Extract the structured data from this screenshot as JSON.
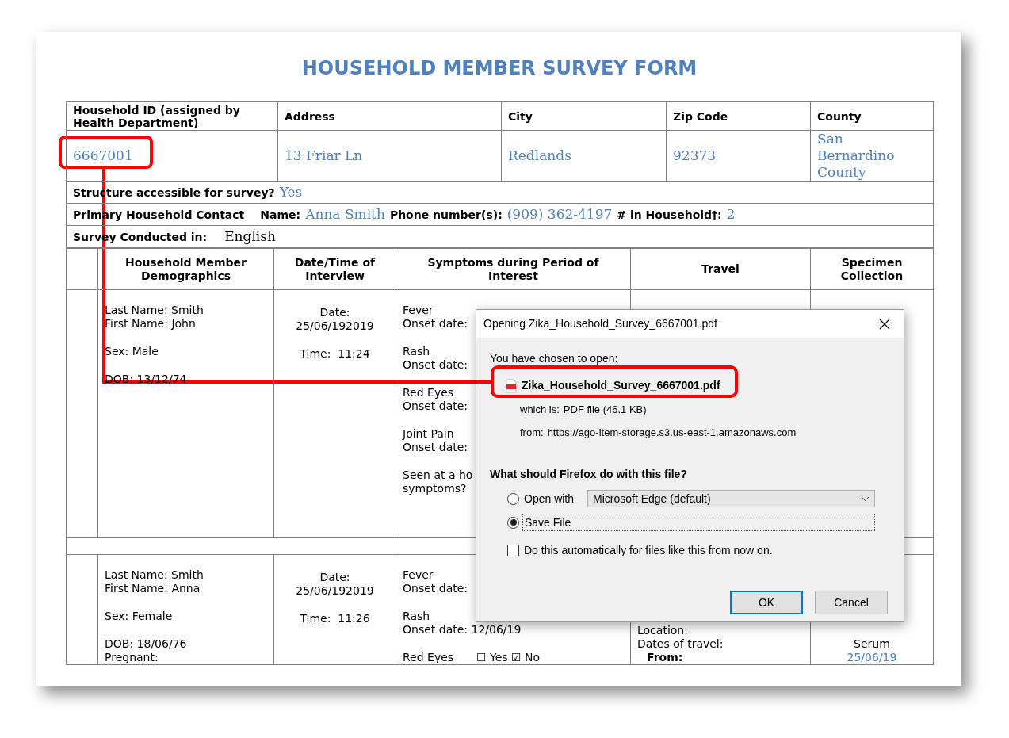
{
  "title": "HOUSEHOLD MEMBER SURVEY FORM",
  "household": {
    "columns": [
      "Household ID (assigned by Health Department)",
      "Address",
      "City",
      "Zip Code",
      "County"
    ],
    "values": [
      "6667001",
      "13 Friar Ln",
      "Redlands",
      "92373",
      "San Bernardino County"
    ]
  },
  "info_rows": [
    {
      "parts": [
        {
          "kind": "label",
          "text": "Structure accessible for survey?"
        },
        {
          "kind": "answer",
          "text": "Yes"
        }
      ]
    },
    {
      "parts": [
        {
          "kind": "section",
          "text": "Primary Household Contact"
        },
        {
          "kind": "label",
          "text": "Name:"
        },
        {
          "kind": "answer",
          "text": "Anna Smith"
        },
        {
          "kind": "label",
          "text": "Phone number(s):"
        },
        {
          "kind": "answer",
          "text": "(909) 362-4197"
        },
        {
          "kind": "label",
          "text": "# in Household†:"
        },
        {
          "kind": "answer",
          "text": "2"
        }
      ]
    },
    {
      "parts": [
        {
          "kind": "label",
          "text": "Survey Conducted in:"
        },
        {
          "kind": "typed",
          "text": "English"
        }
      ]
    }
  ],
  "members": {
    "columns": [
      "Household Member Demographics",
      "Date/Time of Interview",
      "Symptoms during Period of Interest",
      "Travel",
      "Specimen Collection"
    ],
    "rows": [
      {
        "demographics": [
          [
            "Last Name: Smith",
            "First Name: John"
          ],
          [
            "Sex: Male"
          ],
          [
            "DOB: 13/12/74"
          ]
        ],
        "interview": [
          [
            "Date:",
            "25/06/192019"
          ],
          [
            "Time:  11:24"
          ]
        ],
        "symptoms": [
          {
            "lines": [
              "Fever",
              "Onset date:"
            ]
          },
          {
            "lines": [
              "Rash",
              "Onset date:"
            ]
          },
          {
            "lines": [
              "Red Eyes",
              "Onset date:"
            ]
          },
          {
            "lines": [
              "Joint Pain",
              "Onset date:"
            ]
          },
          {
            "lines": [
              "Seen at a ho",
              "symptoms?"
            ]
          }
        ]
      },
      {
        "demographics": [
          [
            "Last Name: Smith",
            "First Name: Anna"
          ],
          [
            "Sex: Female"
          ],
          [
            "DOB: 18/06/76",
            "Pregnant:"
          ]
        ],
        "interview": [
          [
            "Date:",
            "25/06/192019"
          ],
          [
            "Time:  11:26"
          ]
        ],
        "symptoms": [
          {
            "lines": [
              "Fever",
              "Onset date:"
            ]
          },
          {
            "lines": [
              "Rash",
              "Onset date: 12/06/19"
            ]
          },
          {
            "lines": [
              "Red Eyes"
            ],
            "answer": "☐ Yes ☑ No"
          }
        ],
        "travel": [
          {
            "kind": "plain",
            "text": "Location:"
          },
          {
            "kind": "plain",
            "text": "Dates of travel:"
          },
          {
            "kind": "sub",
            "text": "From:"
          }
        ],
        "specimen": [
          {
            "kind": "plain",
            "text": "Serum"
          },
          {
            "kind": "answer",
            "text": "25/06/19"
          }
        ]
      }
    ]
  },
  "dialog": {
    "title": "Opening Zika_Household_Survey_6667001.pdf",
    "intro": "You have chosen to open:",
    "file_name": "Zika_Household_Survey_6667001.pdf",
    "type_label": "which is:",
    "type": "PDF file (46.1 KB)",
    "from_label": "from:",
    "from": "https://ago-item-storage.s3.us-east-1.amazonaws.com",
    "question": "What should Firefox do with this file?",
    "options": [
      {
        "kind": "open_with",
        "label": "Open with",
        "selected": false,
        "app": "Microsoft Edge (default)"
      },
      {
        "kind": "save",
        "label": "Save File",
        "selected": true
      }
    ],
    "auto": {
      "label": "Do this automatically for files like this from now on.",
      "checked": false
    },
    "buttons": [
      {
        "label": "OK",
        "default": true
      },
      {
        "label": "Cancel",
        "default": false
      }
    ]
  }
}
